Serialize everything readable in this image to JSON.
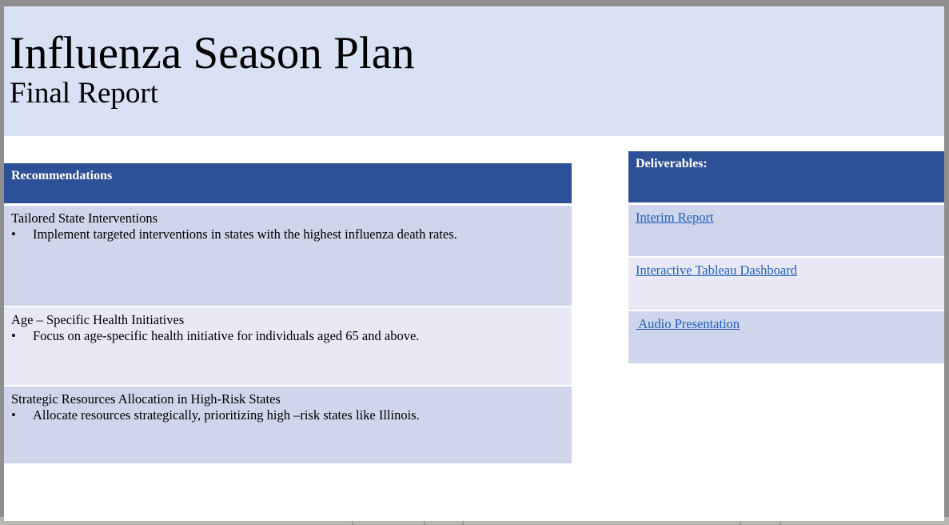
{
  "slide": {
    "title": "Influenza Season Plan",
    "subtitle": "Final Report"
  },
  "recommendations": {
    "header": "Recommendations",
    "bullet_symbol": "•",
    "rows": [
      {
        "heading": "Tailored State Interventions",
        "bullet": "Implement targeted interventions in states with the highest influenza death rates."
      },
      {
        "heading": "Age – Specific Health Initiatives",
        "bullet": "Focus on age-specific health initiative for individuals aged 65 and above."
      },
      {
        "heading": "Strategic Resources Allocation in High-Risk States",
        "bullet": "Allocate resources strategically, prioritizing high –risk states like Illinois."
      }
    ]
  },
  "deliverables": {
    "header": "Deliverables:",
    "links": [
      {
        "label": "Interim Report"
      },
      {
        "label": "Interactive Tableau Dashboard"
      },
      {
        "label": " Audio Presentation"
      }
    ]
  },
  "colors": {
    "title_band": "#d9e1f4",
    "header_fill": "#2e5096",
    "row_dark": "#cfd5ea",
    "row_light": "#e8e9f5",
    "link": "#1f5fbf"
  }
}
